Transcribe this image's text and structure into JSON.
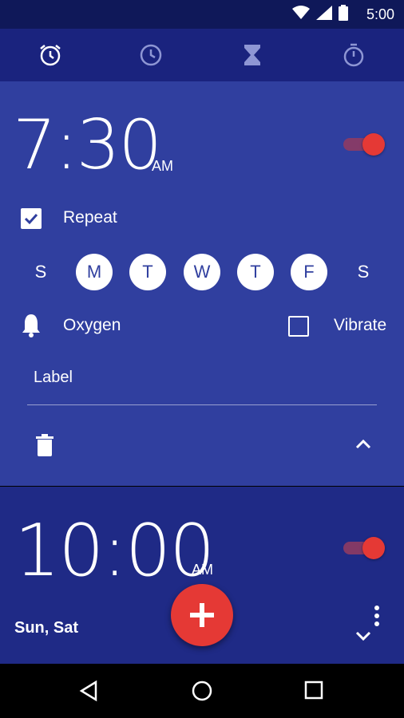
{
  "status_bar": {
    "time": "5:00"
  },
  "tabs": [
    {
      "name": "alarm",
      "icon": "alarm-icon"
    },
    {
      "name": "clock",
      "icon": "clock-icon"
    },
    {
      "name": "timer",
      "icon": "hourglass-icon"
    },
    {
      "name": "stopwatch",
      "icon": "stopwatch-icon"
    }
  ],
  "alarm1": {
    "time": "7:30",
    "ampm": "AM",
    "enabled": true,
    "repeat_label": "Repeat",
    "repeat_checked": true,
    "days": [
      {
        "letter": "S",
        "selected": false
      },
      {
        "letter": "M",
        "selected": true
      },
      {
        "letter": "T",
        "selected": true
      },
      {
        "letter": "W",
        "selected": true
      },
      {
        "letter": "T",
        "selected": true
      },
      {
        "letter": "F",
        "selected": true
      },
      {
        "letter": "S",
        "selected": false
      }
    ],
    "ringtone": "Oxygen",
    "vibrate_label": "Vibrate",
    "vibrate_checked": false,
    "label_placeholder": "Label"
  },
  "alarm2": {
    "time": "10:00",
    "ampm": "AM",
    "enabled": true,
    "days_summary": "Sun, Sat"
  },
  "colors": {
    "accent": "#e53935",
    "primary_dark": "#1a237e",
    "card_expanded": "#303f9f"
  }
}
